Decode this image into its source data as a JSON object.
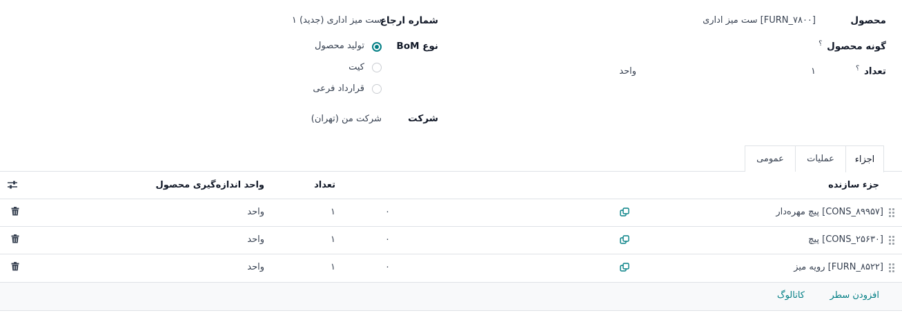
{
  "form": {
    "product_label": "محصول",
    "product_value": "[FURN_۷۸۰۰] ست میز اداری",
    "product_variant_label": "گونه محصول",
    "help_mark": "؟",
    "quantity_label": "تعداد",
    "quantity_value": "۱",
    "quantity_uom": "واحد",
    "reference_label": "شماره ارجاع",
    "reference_value": "ست میز اداری (جدید) ۱",
    "bom_type_label": "نوع BoM",
    "bom_type_options": [
      {
        "label": "تولید محصول",
        "selected": true
      },
      {
        "label": "کیت",
        "selected": false
      },
      {
        "label": "قرارداد فرعی",
        "selected": false
      }
    ],
    "company_label": "شرکت",
    "company_value": "شرکت من (تهران)"
  },
  "tabs": [
    {
      "label": "اجزاء",
      "active": true
    },
    {
      "label": "عملیات",
      "active": false
    },
    {
      "label": "عمومی",
      "active": false
    }
  ],
  "table": {
    "headers": {
      "component": "جزء سازنده",
      "quantity": "تعداد",
      "uom": "واحد اندازه‌گیری محصول"
    },
    "rows": [
      {
        "component": "[CONS_۸۹۹۵۷] پیچ مهره‌دار",
        "extra": "۰",
        "quantity": "۱",
        "uom": "واحد"
      },
      {
        "component": "[CONS_۲۵۶۳۰] پیچ",
        "extra": "۰",
        "quantity": "۱",
        "uom": "واحد"
      },
      {
        "component": "[FURN_۸۵۲۲] رویه میز",
        "extra": "۰",
        "quantity": "۱",
        "uom": "واحد"
      }
    ],
    "add_line_label": "افزودن سطر",
    "catalog_label": "کاتالوگ"
  },
  "colors": {
    "accent": "#017e84",
    "border": "#dee2e6",
    "footer_bg": "#f8f9fa"
  }
}
